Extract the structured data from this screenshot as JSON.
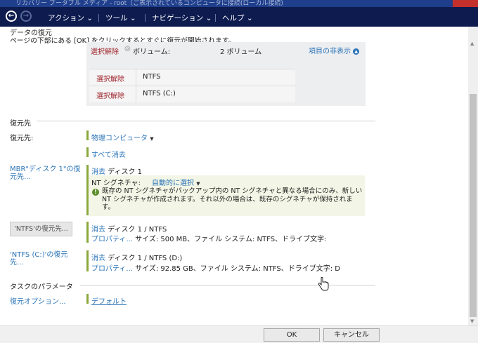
{
  "window": {
    "title": "リカバリー ブータブル メディア - root（ご表示されているコンピュータに接続(ローカル接続)"
  },
  "nav": {
    "back_glyph": "←",
    "forward_glyph": "→",
    "menus": [
      "アクション ⌄",
      "ツール ⌄",
      "ナビゲーション ⌄",
      "ヘルプ ⌄"
    ]
  },
  "header": {
    "title": "データの復元",
    "instruction": "ページの下部にある [OK] をクリックするとすぐに復元が開始されます。"
  },
  "selection_panel": {
    "row1": {
      "clear": "選択解除",
      "volume_label": "ボリューム:",
      "count": "2 ボリューム",
      "hide_items": "項目の非表示"
    },
    "rows": [
      {
        "clear": "選択解除",
        "name": "NTFS"
      },
      {
        "clear": "選択解除",
        "name": "NTFS (C:)"
      }
    ]
  },
  "restore_to": {
    "section_title": "復元先",
    "label": "復元先:",
    "target": "物理コンピュータ",
    "clear_all": "すべて消去"
  },
  "mbr": {
    "label": "MBR\"ディスク 1\"の復元先...",
    "clear": "消去",
    "disk": "ディスク 1",
    "nt_label": "NT シグネチャ:",
    "nt_value": "自動的に選択",
    "info": "既存の NT シグネチャがバックアップ内の NT シグネチャと異なる場合にのみ、新しい NT シグネチャが作成されます。それ以外の場合は、既存のシグネチャが保持されます。"
  },
  "ntfs": {
    "label": "'NTFS'の復元先...",
    "clear": "消去",
    "disk": "ディスク 1 / NTFS",
    "props": "プロパティ...",
    "details": "サイズ: 500 MB、ファイル システム: NTFS、ドライブ文字:"
  },
  "ntfs_c": {
    "label": "'NTFS (C:)'の復元先...",
    "clear": "消去",
    "disk": "ディスク 1 / NTFS (D:)",
    "props": "プロパティ...",
    "details": "サイズ: 92.85 GB、ファイル システム: NTFS、ドライブ文字: D"
  },
  "task_params": {
    "section_title": "タスクのパラメータ",
    "label": "復元オプション...",
    "value": "デフォルト"
  },
  "footer": {
    "ok": "OK",
    "cancel": "キャンセル"
  },
  "colors": {
    "nav_bg": "#0d1b4f",
    "accent_link": "#2a74b8",
    "clear_red": "#a0252b",
    "bar_green": "#8ba83c"
  }
}
